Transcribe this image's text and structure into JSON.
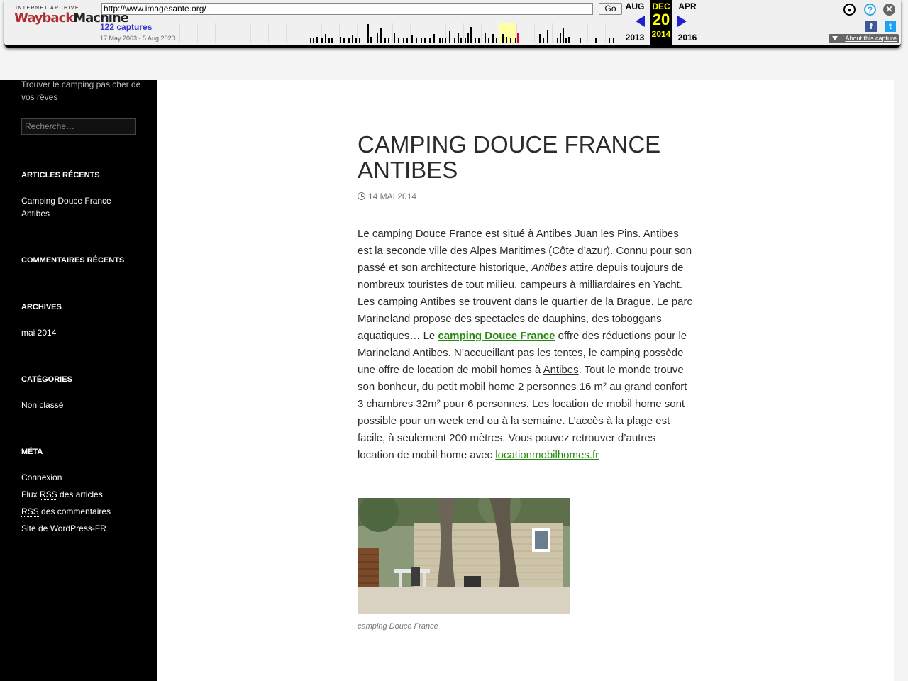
{
  "wayback": {
    "logo_top": "INTERNET ARCHIVE",
    "logo_main_a": "Wayback",
    "logo_main_b": "Machine",
    "url": "http://www.imagesante.org/",
    "go_label": "Go",
    "captures": "122 captures",
    "range": "17 May 2003 - 5 Aug 2020",
    "prev_month": "AUG",
    "prev_year": "2013",
    "cur_month": "DEC",
    "cur_day": "20",
    "cur_year": "2014",
    "next_month": "APR",
    "next_year": "2016",
    "about": "About this capture",
    "icons": [
      "user-icon",
      "help-icon",
      "close-icon",
      "facebook-icon",
      "twitter-icon"
    ]
  },
  "sidebar": {
    "tagline": "Trouver le camping pas cher de vos rêves",
    "search_placeholder": "Recherche…",
    "recent_title": "ARTICLES RÉCENTS",
    "recent_item": "Camping Douce France Antibes",
    "comments_title": "COMMENTAIRES RÉCENTS",
    "archives_title": "ARCHIVES",
    "archives_item": "mai 2014",
    "categories_title": "CATÉGORIES",
    "categories_item": "Non classé",
    "meta_title": "MÉTA",
    "meta_login": "Connexion",
    "meta_flux_a": "Flux ",
    "meta_flux_rss": "RSS",
    "meta_flux_b": " des articles",
    "meta_rss2": "RSS",
    "meta_comments": " des commentaires",
    "meta_wp": "Site de WordPress-FR"
  },
  "post": {
    "title": "CAMPING DOUCE FRANCE ANTIBES",
    "date": "14 MAI 2014",
    "p1": "Le camping Douce France est situé à Antibes Juan les Pins. Antibes est la seconde ville des Alpes Maritimes (Côte d’azur). Connu pour son passé et son architecture historique, ",
    "p_italic": "Antibes",
    "p2": " attire depuis toujours de nombreux touristes de tout milieu, campeurs à milliardaires en Yacht. Les camping Antibes se trouvent dans le quartier de la Brague.  Le parc Marineland propose des spectacles de dauphins, des toboggans aquatiques… Le ",
    "link1": "camping Douce France",
    "p3": " offre des réductions pour le Marineland Antibes. N’accueillant pas les tentes, le camping possède une offre de location de mobil homes à ",
    "link2": "Antibes",
    "p4": ". Tout le monde trouve son bonheur, du petit mobil home 2 personnes 16 m² au grand confort 3 chambres 32m² pour 6 personnes. Les location de mobil home sont possible pour un week end ou à la semaine. L’accès à la plage est facile, à seulement 200 mètres. Vous pouvez retrouver d’autres location de mobil home avec ",
    "link3": "locationmobilhomes.fr",
    "caption": "camping Douce France"
  }
}
